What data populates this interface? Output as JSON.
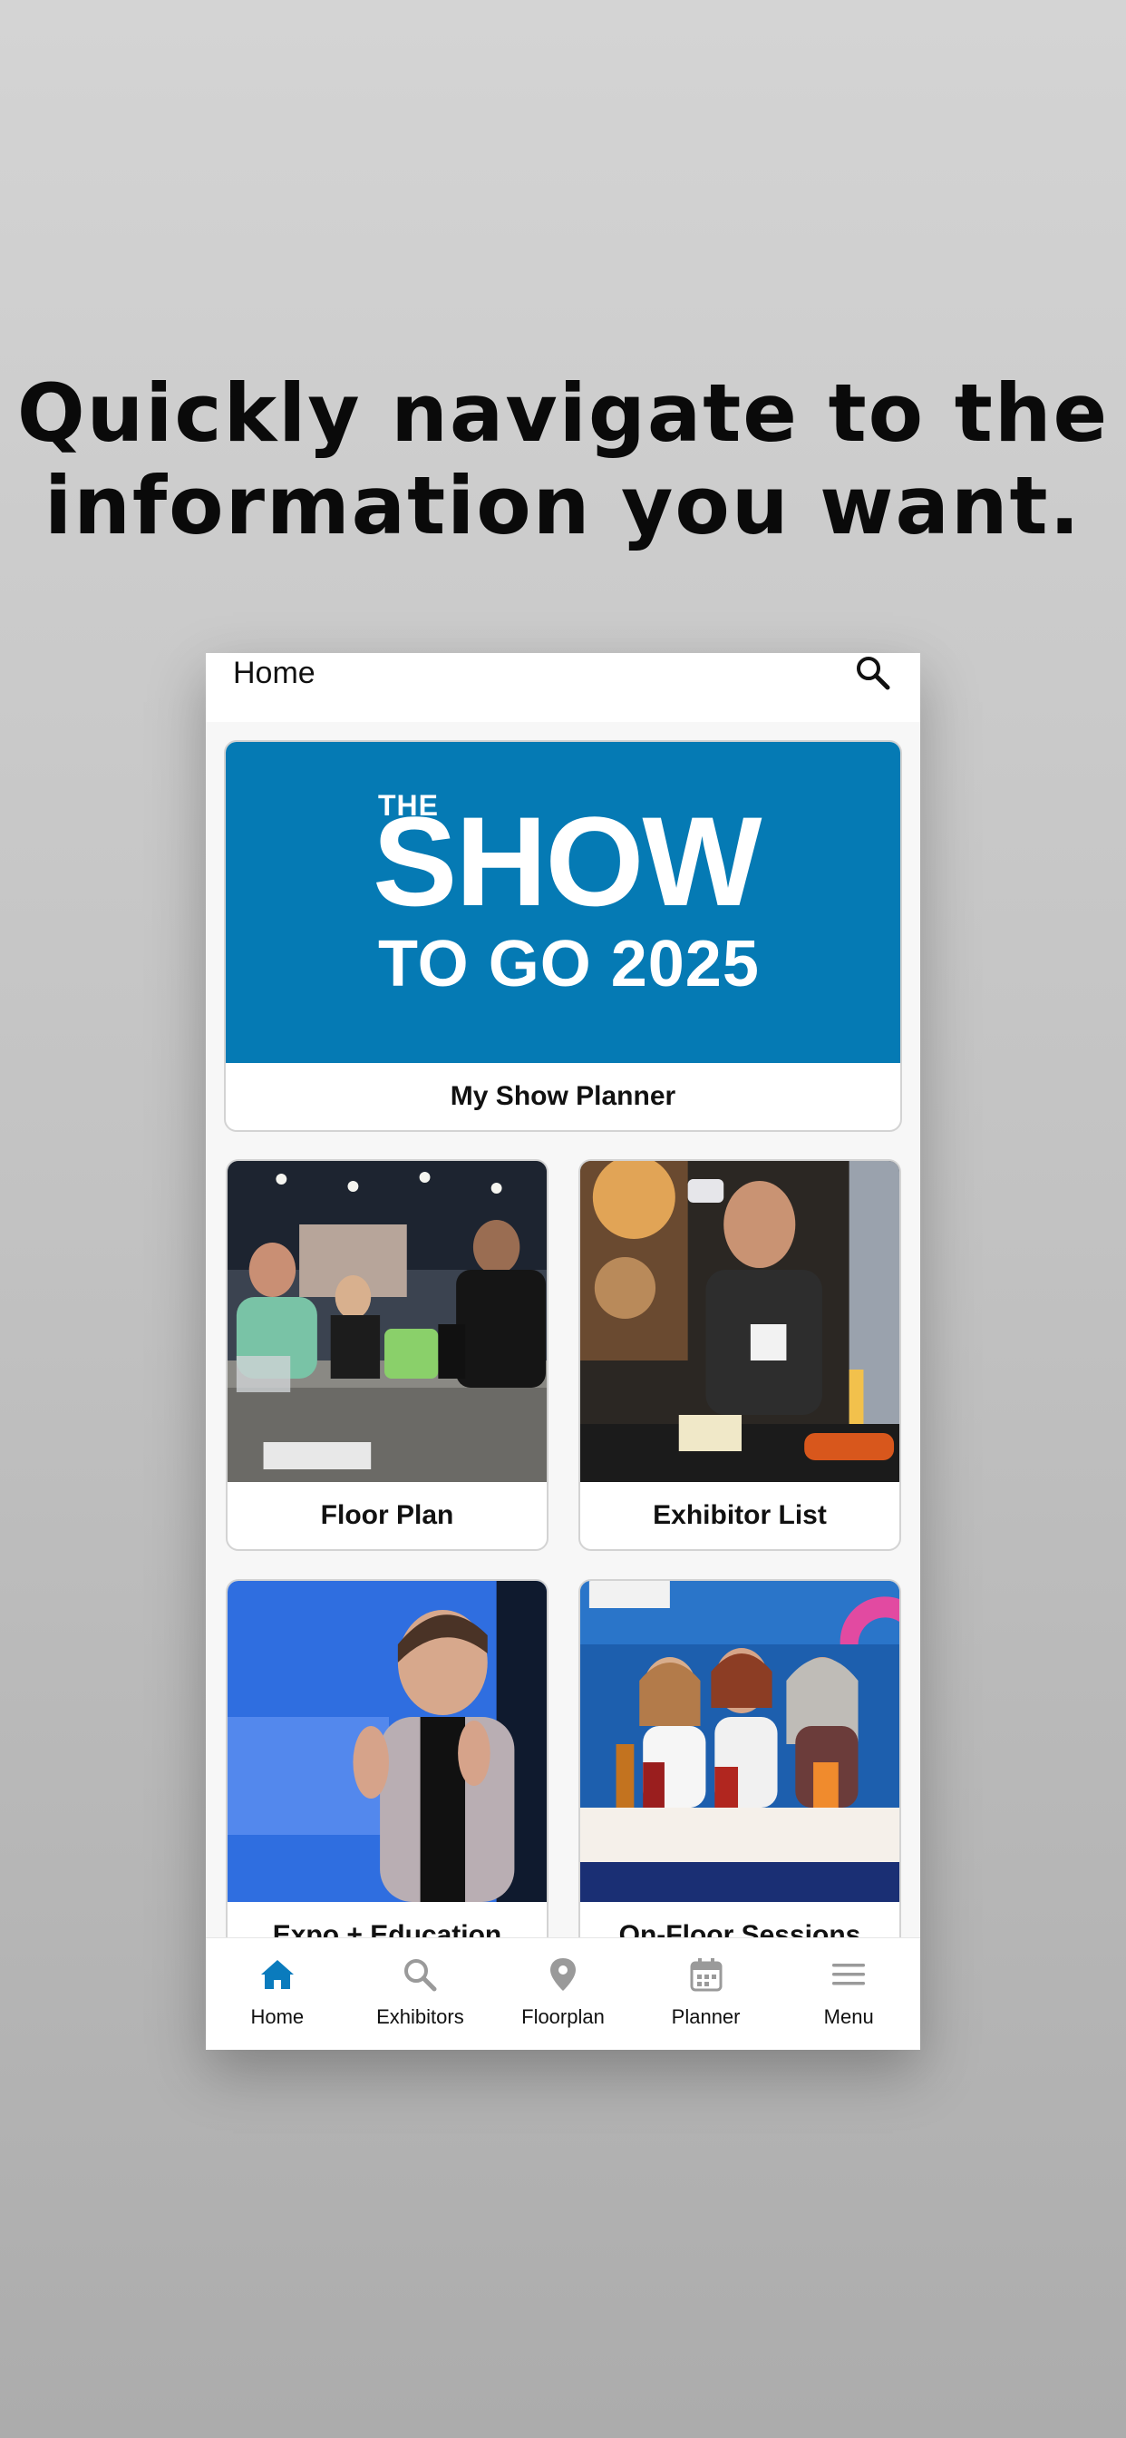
{
  "headline": {
    "line1": "Quickly navigate to the",
    "line2": "information you want."
  },
  "app": {
    "title": "Home",
    "search_icon": "search-icon"
  },
  "hero": {
    "logo_the": "THE",
    "logo_show": "SHOW",
    "logo_togo": "TO GO 2025",
    "label": "My Show Planner",
    "banner_color": "#057ab4"
  },
  "tiles": [
    {
      "label": "Floor Plan"
    },
    {
      "label": "Exhibitor List"
    },
    {
      "label": "Expo + Education"
    },
    {
      "label": "On-Floor Sessions"
    }
  ],
  "tabbar": {
    "active_color": "#0a7bbd",
    "inactive_color": "#9a9a9a",
    "items": [
      {
        "label": "Home",
        "icon": "home-icon",
        "active": true
      },
      {
        "label": "Exhibitors",
        "icon": "search-icon",
        "active": false
      },
      {
        "label": "Floorplan",
        "icon": "map-pin-icon",
        "active": false
      },
      {
        "label": "Planner",
        "icon": "calendar-icon",
        "active": false
      },
      {
        "label": "Menu",
        "icon": "hamburger-menu-icon",
        "active": false
      }
    ]
  }
}
